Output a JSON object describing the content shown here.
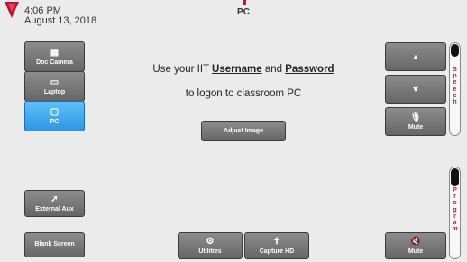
{
  "header": {
    "time": "4:06 PM",
    "date": "August 13, 2018",
    "title": "PC"
  },
  "main": {
    "line1_prefix": "Use your IIT ",
    "line1_username": "Username",
    "line1_and": " and ",
    "line1_password": "Password",
    "line2": "to logon to classroom PC",
    "adjust_image_label": "Adjust Image"
  },
  "sources": {
    "doc_camera": "Doc Camera",
    "laptop": "Laptop",
    "pc": "PC",
    "external_aux": "External Aux",
    "blank_screen": "Blank Screen"
  },
  "bottom": {
    "utilities": "Utilities",
    "capture_hd": "Capture HD"
  },
  "audio": {
    "up_icon": "triangle-up-icon",
    "down_icon": "triangle-down-icon",
    "speech_mute": "Mute",
    "program_mute": "Mute",
    "speech_label": "Speech",
    "program_label": "Program",
    "speech_level": 0.14,
    "program_level": 0.2
  },
  "colors": {
    "active": "#3aa6ee",
    "slider_label": "#d01818"
  }
}
